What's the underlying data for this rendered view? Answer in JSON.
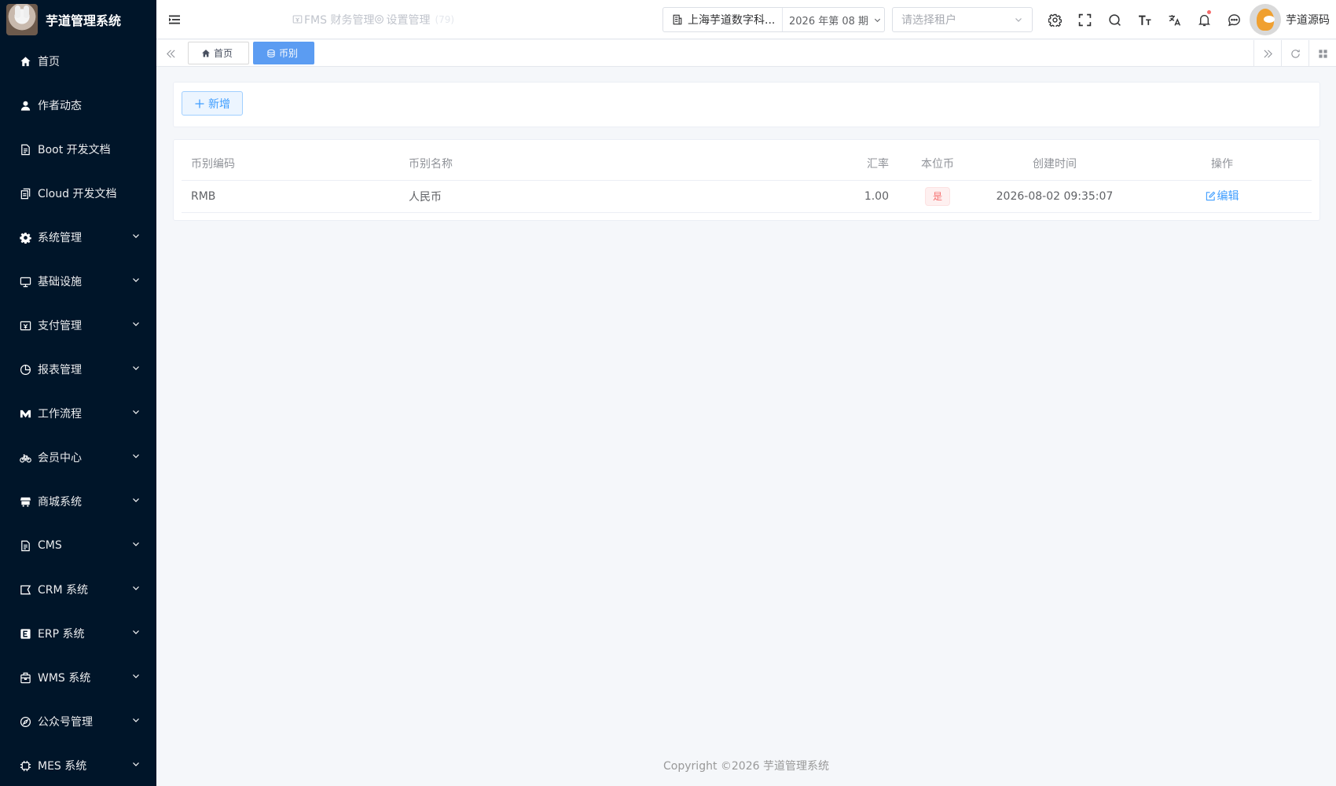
{
  "app": {
    "title": "芋道管理系统"
  },
  "sidebar": {
    "items": [
      {
        "label": "首页",
        "icon": "home-icon",
        "expandable": false
      },
      {
        "label": "作者动态",
        "icon": "user-icon",
        "expandable": false
      },
      {
        "label": "Boot 开发文档",
        "icon": "document-icon",
        "expandable": false
      },
      {
        "label": "Cloud 开发文档",
        "icon": "documents-icon",
        "expandable": false
      },
      {
        "label": "系统管理",
        "icon": "gear-icon",
        "expandable": true
      },
      {
        "label": "基础设施",
        "icon": "monitor-icon",
        "expandable": true
      },
      {
        "label": "支付管理",
        "icon": "payment-icon",
        "expandable": true
      },
      {
        "label": "报表管理",
        "icon": "pie-chart-icon",
        "expandable": true
      },
      {
        "label": "工作流程",
        "icon": "workflow-icon",
        "expandable": true
      },
      {
        "label": "会员中心",
        "icon": "bicycle-icon",
        "expandable": true
      },
      {
        "label": "商城系统",
        "icon": "shop-icon",
        "expandable": true
      },
      {
        "label": "CMS",
        "icon": "document-icon",
        "expandable": true
      },
      {
        "label": "CRM 系统",
        "icon": "crm-icon",
        "expandable": true
      },
      {
        "label": "ERP 系统",
        "icon": "erp-icon",
        "expandable": true
      },
      {
        "label": "WMS 系统",
        "icon": "warehouse-icon",
        "expandable": true
      },
      {
        "label": "公众号管理",
        "icon": "compass-icon",
        "expandable": true
      },
      {
        "label": "MES 系统",
        "icon": "chip-icon",
        "expandable": true
      }
    ]
  },
  "header": {
    "nav": [
      {
        "label": "FMS 财务管理",
        "icon": "finance-icon"
      },
      {
        "label": "设置管理",
        "icon": "gear-icon",
        "count": "(79)"
      }
    ],
    "company": "上海芋道数字科...",
    "period": "2026 年第 08 期",
    "tenant_placeholder": "请选择租户",
    "user_name": "芋道源码"
  },
  "tags": [
    {
      "label": "首页",
      "icon": "home-icon",
      "active": false
    },
    {
      "label": "币别",
      "icon": "coin-icon",
      "active": true
    }
  ],
  "toolbar": {
    "add_label": "新增"
  },
  "table": {
    "headers": {
      "code": "币别编码",
      "name": "币别名称",
      "rate": "汇率",
      "base": "本位币",
      "created": "创建时间",
      "actions": "操作"
    },
    "rows": [
      {
        "code": "RMB",
        "name": "人民币",
        "rate": "1.00",
        "base": "是",
        "created": "2026-08-02 09:35:07",
        "action": "编辑"
      }
    ]
  },
  "footer": {
    "copyright": "Copyright ©2026 芋道管理系统"
  },
  "colors": {
    "sidebar_bg": "#001529",
    "primary": "#409eff",
    "active_tag": "#5b9cf2",
    "danger": "#f56c6c"
  }
}
